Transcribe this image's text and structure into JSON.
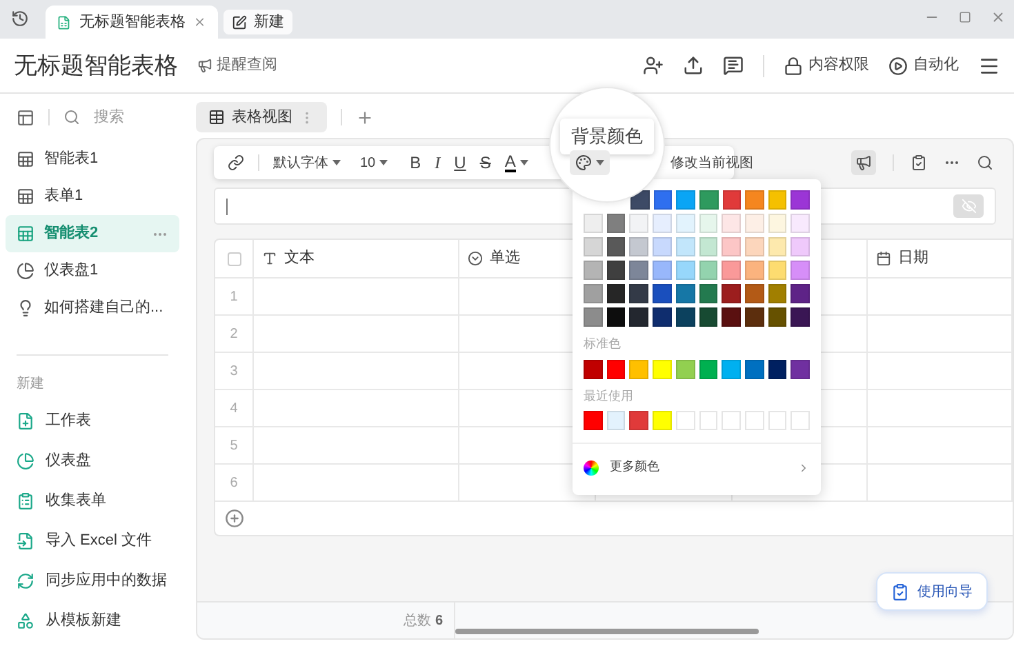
{
  "tabs_bar": {
    "tabs": [
      {
        "label": "无标题智能表格",
        "selected": true
      },
      {
        "label": "新建",
        "selected": false
      }
    ]
  },
  "header": {
    "title": "无标题智能表格",
    "remind": "提醒查阅",
    "actions": [
      {
        "label": "内容权限",
        "kind": "lock"
      },
      {
        "label": "自动化",
        "kind": "play"
      }
    ]
  },
  "sidebar": {
    "search_placeholder": "搜索",
    "items": [
      {
        "label": "智能表1",
        "kind": "sheet",
        "selected": false
      },
      {
        "label": "表单1",
        "kind": "sheet",
        "selected": false
      },
      {
        "label": "智能表2",
        "kind": "sheet",
        "selected": true
      },
      {
        "label": "仪表盘1",
        "kind": "dashboard",
        "selected": false
      },
      {
        "label": "如何搭建自己的...",
        "kind": "guide",
        "selected": false
      }
    ],
    "new_heading": "新建",
    "new_items": [
      {
        "label": "工作表",
        "kind": "sheet"
      },
      {
        "label": "仪表盘",
        "kind": "dashboard"
      },
      {
        "label": "收集表单",
        "kind": "form"
      },
      {
        "label": "导入 Excel 文件",
        "kind": "import"
      },
      {
        "label": "同步应用中的数据",
        "kind": "sync"
      },
      {
        "label": "从模板新建",
        "kind": "template"
      }
    ]
  },
  "view_tabs": [
    {
      "label": "表格视图",
      "selected": true
    }
  ],
  "toolbar": {
    "font": "默认字体",
    "size": "10",
    "bold": "B",
    "italic": "I",
    "underline": "U",
    "strike": "S",
    "text_color": "A",
    "note": "修改当前视图"
  },
  "tooltip": "背景颜色",
  "color_menu": {
    "theme_rows": [
      {
        "hidden_leading": true,
        "swatches": [
          {
            "color": "#3d4a66"
          },
          {
            "color": "#2f6fef"
          },
          {
            "color": "#0aa5f5"
          },
          {
            "color": "#2e9a5e"
          },
          {
            "color": "#e03a3a"
          },
          {
            "color": "#f5861f"
          },
          {
            "color": "#f5c000"
          },
          {
            "color": "#9b35d6"
          }
        ]
      },
      {
        "hidden_leading": false,
        "swatches": [
          {
            "color": "#eeeeee"
          },
          {
            "color": "#7f7f7f"
          },
          {
            "color": "#f2f3f5"
          },
          {
            "color": "#e6eefe"
          },
          {
            "color": "#e2f3fd"
          },
          {
            "color": "#e6f6ec"
          },
          {
            "color": "#fde6e6"
          },
          {
            "color": "#fdefe6"
          },
          {
            "color": "#fdf6e0"
          },
          {
            "color": "#f8e9fd"
          }
        ]
      },
      {
        "hidden_leading": false,
        "swatches": [
          {
            "color": "#d6d6d6"
          },
          {
            "color": "#595959"
          },
          {
            "color": "#c4c8d0"
          },
          {
            "color": "#c8d9fd"
          },
          {
            "color": "#c2e6fb"
          },
          {
            "color": "#c3e7d2"
          },
          {
            "color": "#fcc6c6"
          },
          {
            "color": "#fcd6bc"
          },
          {
            "color": "#fde9ad"
          },
          {
            "color": "#efc9fb"
          }
        ]
      },
      {
        "hidden_leading": false,
        "swatches": [
          {
            "color": "#b4b4b4"
          },
          {
            "color": "#3f3f3f"
          },
          {
            "color": "#7d8699"
          },
          {
            "color": "#98b7fb"
          },
          {
            "color": "#97d7fb"
          },
          {
            "color": "#93d3ae"
          },
          {
            "color": "#fa9999"
          },
          {
            "color": "#fbb37e"
          },
          {
            "color": "#fddc70"
          },
          {
            "color": "#d68ef8"
          }
        ]
      },
      {
        "hidden_leading": false,
        "swatches": [
          {
            "color": "#a0a0a0"
          },
          {
            "color": "#262626"
          },
          {
            "color": "#333a47"
          },
          {
            "color": "#1a4fbd"
          },
          {
            "color": "#1677a6"
          },
          {
            "color": "#237a4f"
          },
          {
            "color": "#9c1e1e"
          },
          {
            "color": "#b35a16"
          },
          {
            "color": "#a17f00"
          },
          {
            "color": "#5e2387"
          }
        ]
      },
      {
        "hidden_leading": false,
        "swatches": [
          {
            "color": "#8c8c8c"
          },
          {
            "color": "#0d0d0d"
          },
          {
            "color": "#23272f"
          },
          {
            "color": "#0f2d6e"
          },
          {
            "color": "#0c415e"
          },
          {
            "color": "#174a32"
          },
          {
            "color": "#5a1010"
          },
          {
            "color": "#5c2e0d"
          },
          {
            "color": "#665100"
          },
          {
            "color": "#3a1654"
          }
        ]
      }
    ],
    "standard_label": "标准色",
    "standard": [
      {
        "color": "#c00000"
      },
      {
        "color": "#ff0000"
      },
      {
        "color": "#ffc000"
      },
      {
        "color": "#ffff00"
      },
      {
        "color": "#92d050"
      },
      {
        "color": "#00b050"
      },
      {
        "color": "#00b0f0"
      },
      {
        "color": "#0070c0"
      },
      {
        "color": "#002060"
      },
      {
        "color": "#7030a0"
      }
    ],
    "recent_label": "最近使用",
    "recent": [
      {
        "kind": "swatch",
        "color": "#ff0000"
      },
      {
        "kind": "swatch",
        "color": "#e3f2fd"
      },
      {
        "kind": "swatch",
        "color": "#e03a3a"
      },
      {
        "kind": "swatch",
        "color": "#ffff00"
      },
      {
        "kind": "empty"
      },
      {
        "kind": "empty"
      },
      {
        "kind": "empty"
      },
      {
        "kind": "empty"
      },
      {
        "kind": "empty"
      },
      {
        "kind": "empty"
      }
    ],
    "more": "更多颜色"
  },
  "table": {
    "all_checked": false,
    "columns": [
      {
        "kind": "text",
        "label": "文本"
      },
      {
        "kind": "select",
        "label": "单选"
      },
      {
        "kind": "covered"
      },
      {
        "kind": "covered"
      },
      {
        "kind": "date",
        "label": "日期"
      }
    ],
    "rows": [
      "1",
      "2",
      "3",
      "4",
      "5",
      "6"
    ],
    "total_label": "总数",
    "total": "6"
  },
  "guide_button": "使用向导"
}
